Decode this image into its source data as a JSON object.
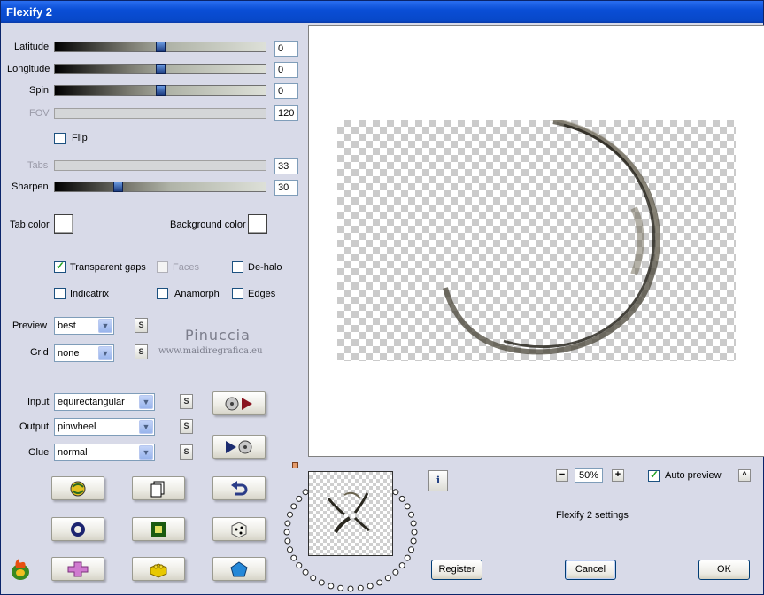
{
  "window": {
    "title": "Flexify 2"
  },
  "sliders": [
    {
      "label": "Latitude",
      "value": "0",
      "enabled": true,
      "level": 0.5
    },
    {
      "label": "Longitude",
      "value": "0",
      "enabled": true,
      "level": 0.5
    },
    {
      "label": "Spin",
      "value": "0",
      "enabled": true,
      "level": 0.5
    },
    {
      "label": "FOV",
      "value": "120",
      "enabled": false
    },
    {
      "label": "Tabs",
      "value": "33",
      "enabled": false
    },
    {
      "label": "Sharpen",
      "value": "30",
      "enabled": true,
      "level": 0.3
    }
  ],
  "flip": {
    "label": "Flip",
    "checked": false
  },
  "colors": {
    "tab_label": "Tab color",
    "tab_value": "#ffffff",
    "bg_label": "Background color",
    "bg_value": "#ffffff"
  },
  "options": {
    "transparent_gaps": {
      "label": "Transparent gaps",
      "checked": true
    },
    "faces": {
      "label": "Faces",
      "checked": false,
      "enabled": false
    },
    "dehalo": {
      "label": "De-halo",
      "checked": false
    },
    "indicatrix": {
      "label": "Indicatrix",
      "checked": false
    },
    "anamorph": {
      "label": "Anamorph",
      "checked": false
    },
    "edges": {
      "label": "Edges",
      "checked": false
    }
  },
  "selects": {
    "preview": {
      "label": "Preview",
      "value": "best"
    },
    "grid": {
      "label": "Grid",
      "value": "none"
    },
    "input": {
      "label": "Input",
      "value": "equirectangular"
    },
    "output": {
      "label": "Output",
      "value": "pinwheel"
    },
    "glue": {
      "label": "Glue",
      "value": "normal"
    }
  },
  "small_button_label": "S",
  "watermark": {
    "name": "Pinuccia",
    "site": "www.maidiregrafica.eu"
  },
  "zoom": {
    "minus": "−",
    "value": "50%",
    "plus": "+"
  },
  "auto_preview": {
    "label": "Auto preview",
    "checked": true
  },
  "collapse_label": "^",
  "info_label": "i",
  "settings_label": "Flexify 2 settings",
  "buttons": {
    "register": "Register",
    "cancel": "Cancel",
    "ok": "OK"
  },
  "icons": {
    "row1": [
      "randomize-globe-icon",
      "copy-pages-icon",
      "undo-arrow-icon"
    ],
    "row2": [
      "ring-icon",
      "green-square-icon",
      "dice-icon"
    ],
    "row3": [
      "pink-cross-icon",
      "yellow-block-icon",
      "blue-pentagon-icon"
    ],
    "corner": "flame-logo-icon"
  },
  "accent_colors": {
    "titlebar": "#0a4ed6",
    "slider_thumb": "#1c3c80",
    "check_mark": "#21a121"
  }
}
